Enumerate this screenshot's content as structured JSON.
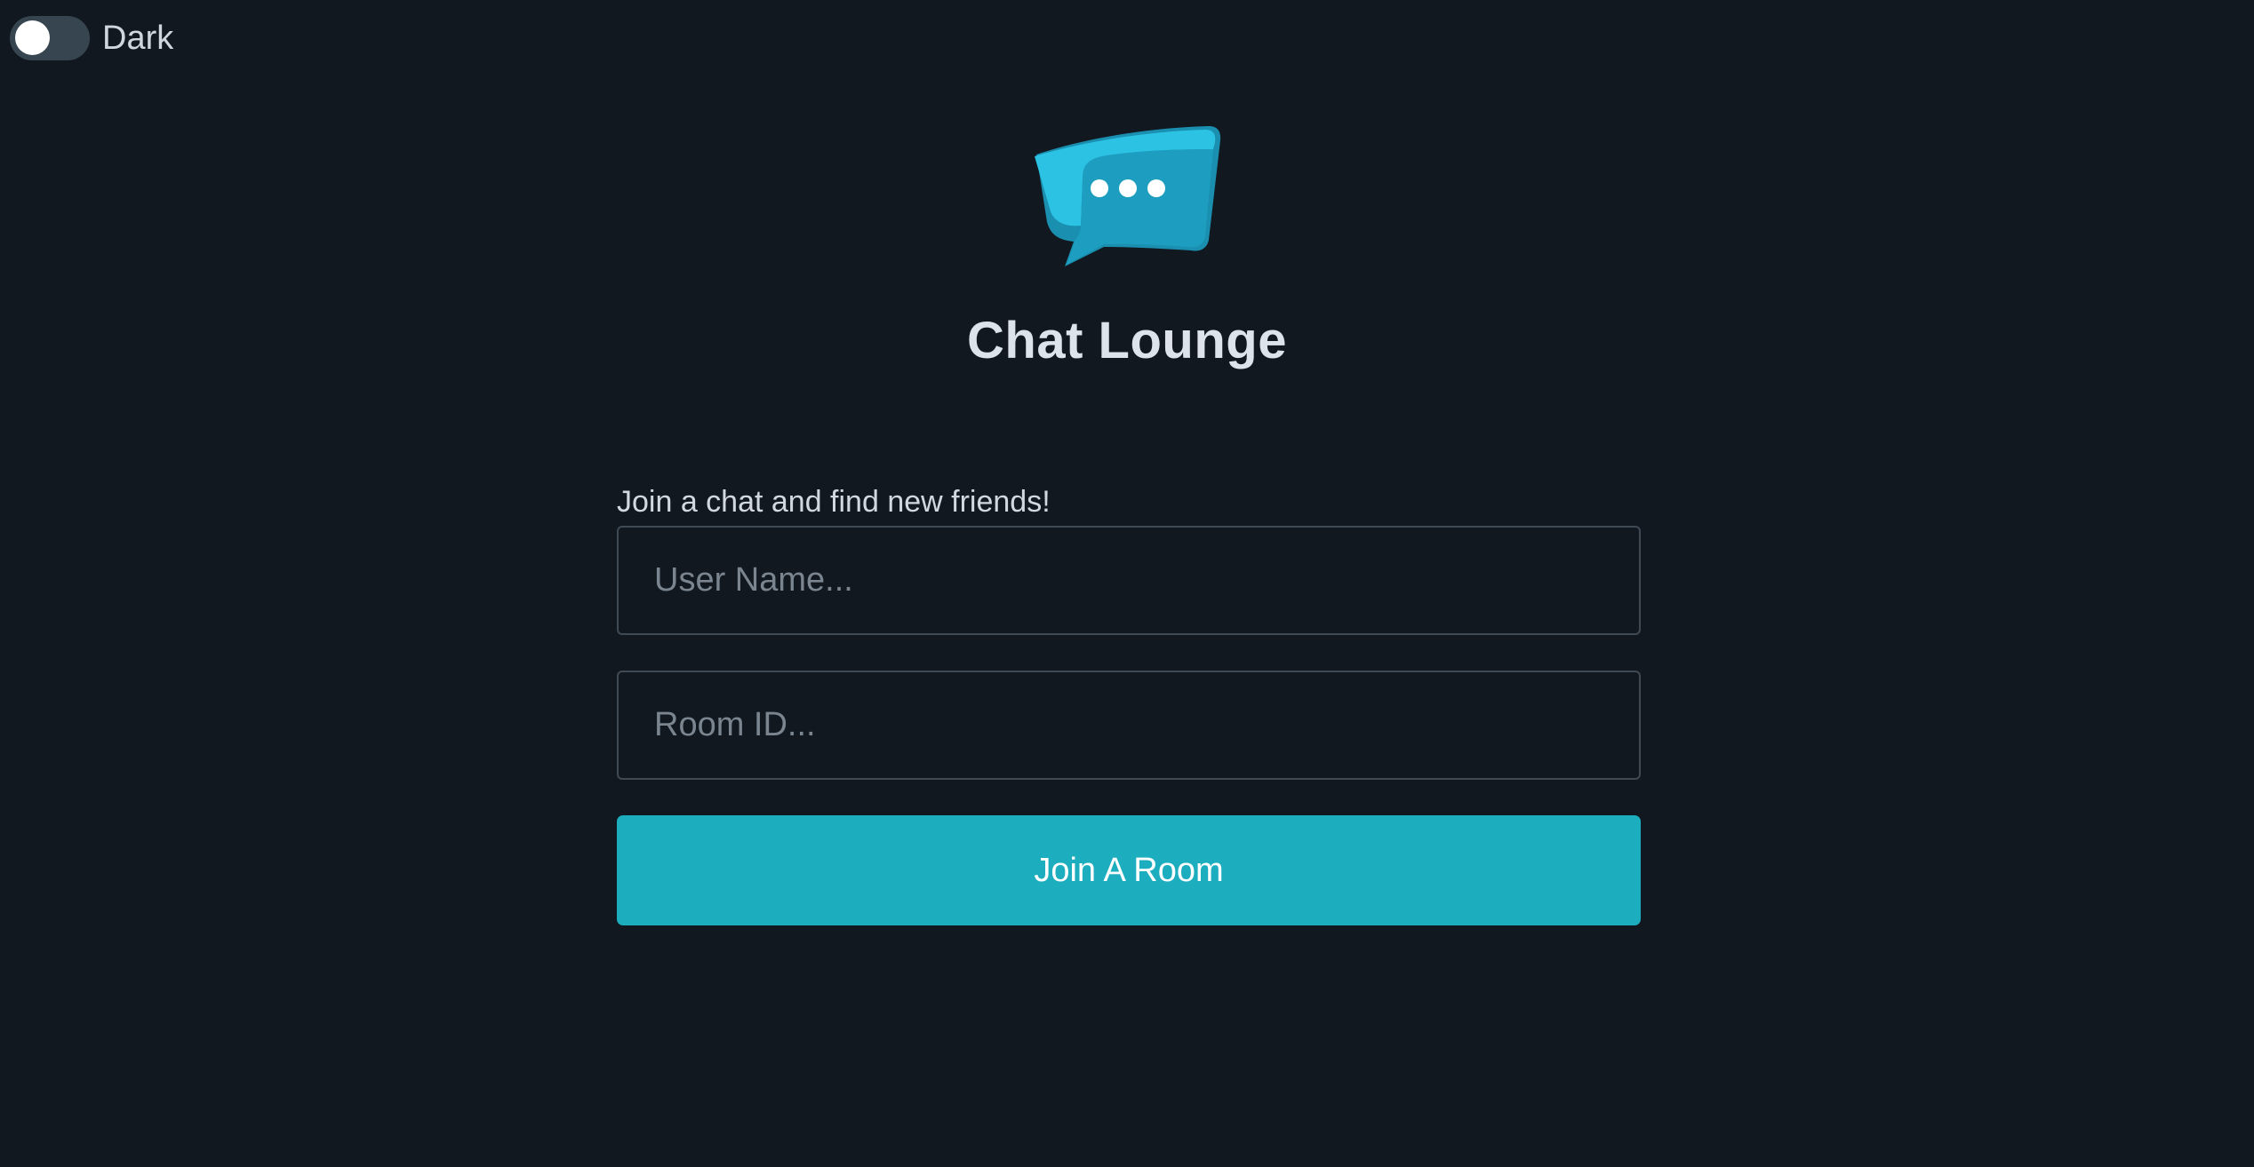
{
  "theme_toggle": {
    "label": "Dark",
    "checked": false
  },
  "logo": {
    "icon": "chat-bubble-icon",
    "color": "#23b5d3"
  },
  "header": {
    "title": "Chat Lounge"
  },
  "form": {
    "tagline": "Join a chat and find new friends!",
    "username": {
      "placeholder": "User Name...",
      "value": ""
    },
    "room_id": {
      "placeholder": "Room ID...",
      "value": ""
    },
    "submit_label": "Join A Room"
  },
  "colors": {
    "background": "#121820",
    "accent": "#1cadbf",
    "toggle_track": "#36454f"
  }
}
